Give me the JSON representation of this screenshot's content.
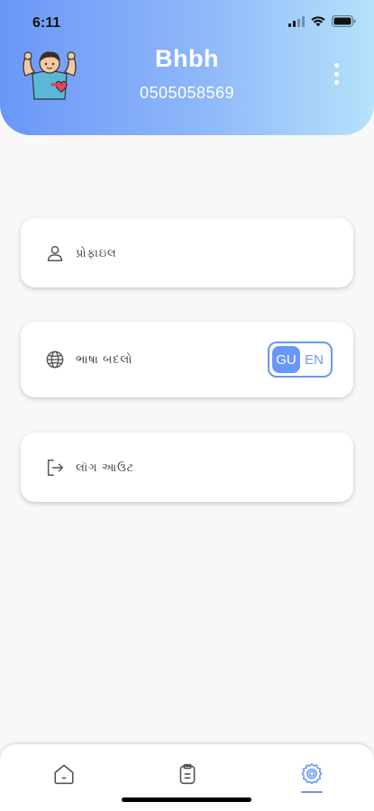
{
  "status_bar": {
    "time": "6:11"
  },
  "profile": {
    "name": "Bhbh",
    "phone": "0505058569"
  },
  "menu": {
    "profile_label": "પ્રોફાઇલ",
    "language_label": "ભાષા બદલો",
    "logout_label": "લૉગ આઉટ"
  },
  "language_toggle": {
    "options": [
      "GU",
      "EN"
    ],
    "selected": "GU"
  },
  "tabs": {
    "active": "settings"
  },
  "colors": {
    "accent": "#6a97f7",
    "header_start": "#6a97f7",
    "header_end": "#b6e2fb"
  }
}
